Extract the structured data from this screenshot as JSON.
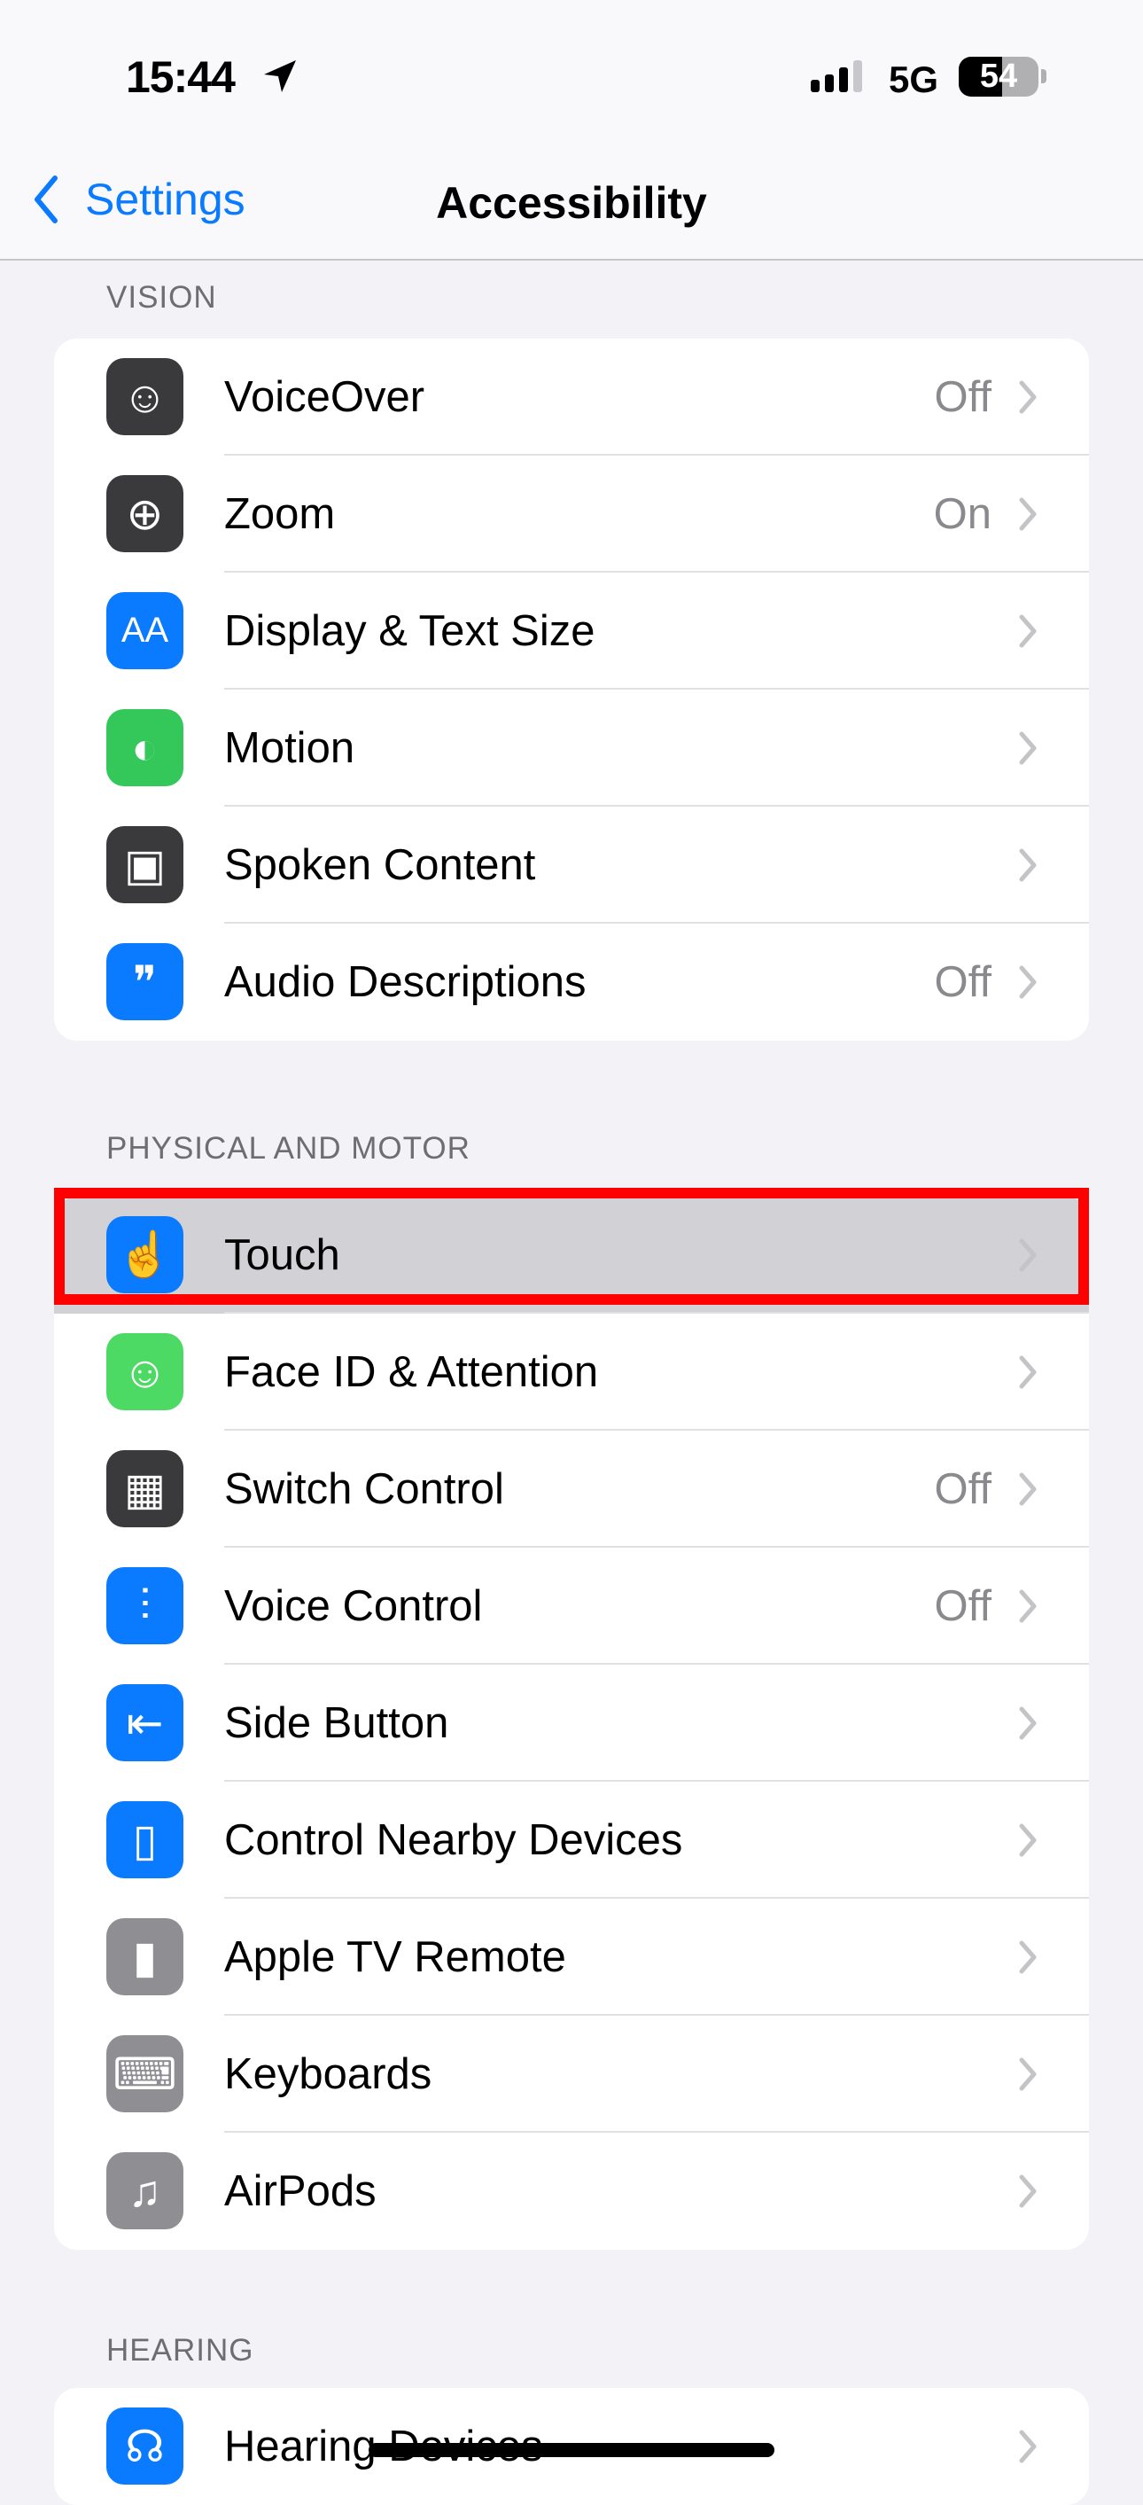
{
  "status": {
    "time": "15:44",
    "network": "5G",
    "battery": "54",
    "battery_level": 54
  },
  "nav": {
    "back_label": "Settings",
    "title": "Accessibility"
  },
  "colors": {
    "accent": "#0a7aff",
    "highlight": "#d1d1d6",
    "annotation": "#ff0000"
  },
  "sections": [
    {
      "header": "VISION",
      "items": [
        {
          "label": "VoiceOver",
          "value": "Off",
          "icon": "voiceover-icon",
          "color": "#3a3a3c",
          "glyph": "☺"
        },
        {
          "label": "Zoom",
          "value": "On",
          "icon": "zoom-icon",
          "color": "#3a3a3c",
          "glyph": "⊕"
        },
        {
          "label": "Display & Text Size",
          "value": "",
          "icon": "text-size-icon",
          "color": "#0a7aff",
          "glyph": "AA"
        },
        {
          "label": "Motion",
          "value": "",
          "icon": "motion-icon",
          "color": "#34c759",
          "glyph": "◐"
        },
        {
          "label": "Spoken Content",
          "value": "",
          "icon": "speech-bubble-icon",
          "color": "#3a3a3c",
          "glyph": "▣"
        },
        {
          "label": "Audio Descriptions",
          "value": "Off",
          "icon": "quote-bubble-icon",
          "color": "#0a7aff",
          "glyph": "❞"
        }
      ]
    },
    {
      "header": "PHYSICAL AND MOTOR",
      "items": [
        {
          "label": "Touch",
          "value": "",
          "icon": "hand-pointing-icon",
          "color": "#0a7aff",
          "glyph": "☝",
          "highlighted": true
        },
        {
          "label": "Face ID & Attention",
          "value": "",
          "icon": "face-id-icon",
          "color": "#4cd964",
          "glyph": "☺"
        },
        {
          "label": "Switch Control",
          "value": "Off",
          "icon": "grid-icon",
          "color": "#3a3a3c",
          "glyph": "▦"
        },
        {
          "label": "Voice Control",
          "value": "Off",
          "icon": "waveform-icon",
          "color": "#0a7aff",
          "glyph": "⫶"
        },
        {
          "label": "Side Button",
          "value": "",
          "icon": "side-button-icon",
          "color": "#0a7aff",
          "glyph": "⇤"
        },
        {
          "label": "Control Nearby Devices",
          "value": "",
          "icon": "nearby-devices-icon",
          "color": "#0a7aff",
          "glyph": "▯"
        },
        {
          "label": "Apple TV Remote",
          "value": "",
          "icon": "remote-icon",
          "color": "#8e8e93",
          "glyph": "▮"
        },
        {
          "label": "Keyboards",
          "value": "",
          "icon": "keyboard-icon",
          "color": "#8e8e93",
          "glyph": "⌨"
        },
        {
          "label": "AirPods",
          "value": "",
          "icon": "airpods-icon",
          "color": "#8e8e93",
          "glyph": "♫"
        }
      ]
    },
    {
      "header": "HEARING",
      "items": [
        {
          "label": "Hearing Devices",
          "value": "",
          "icon": "ear-icon",
          "color": "#0a7aff",
          "glyph": "☊"
        }
      ]
    }
  ]
}
